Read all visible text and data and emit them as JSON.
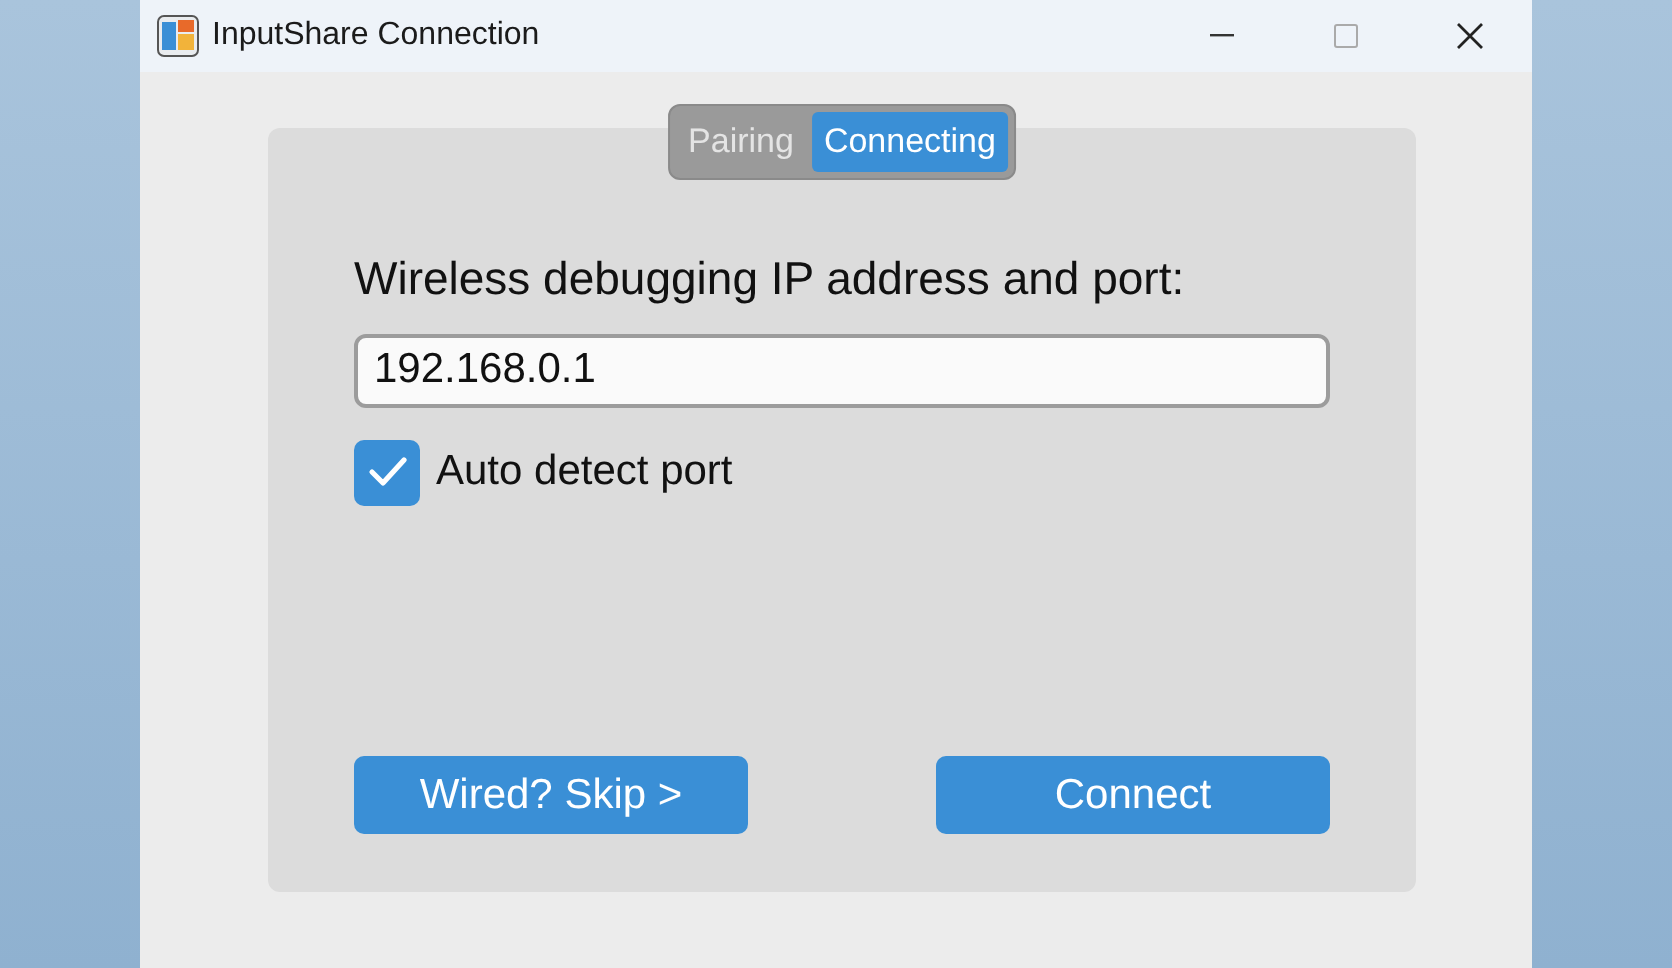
{
  "window": {
    "title": "InputShare Connection"
  },
  "tabs": [
    {
      "label": "Pairing",
      "selected": false
    },
    {
      "label": "Connecting",
      "selected": true
    }
  ],
  "form": {
    "label": "Wireless debugging IP address and port:",
    "value": "192.168.0.1",
    "auto_detect": {
      "label": "Auto detect port",
      "checked": true
    }
  },
  "buttons": [
    {
      "label": "Wired? Skip >"
    },
    {
      "label": "Connect"
    }
  ]
}
